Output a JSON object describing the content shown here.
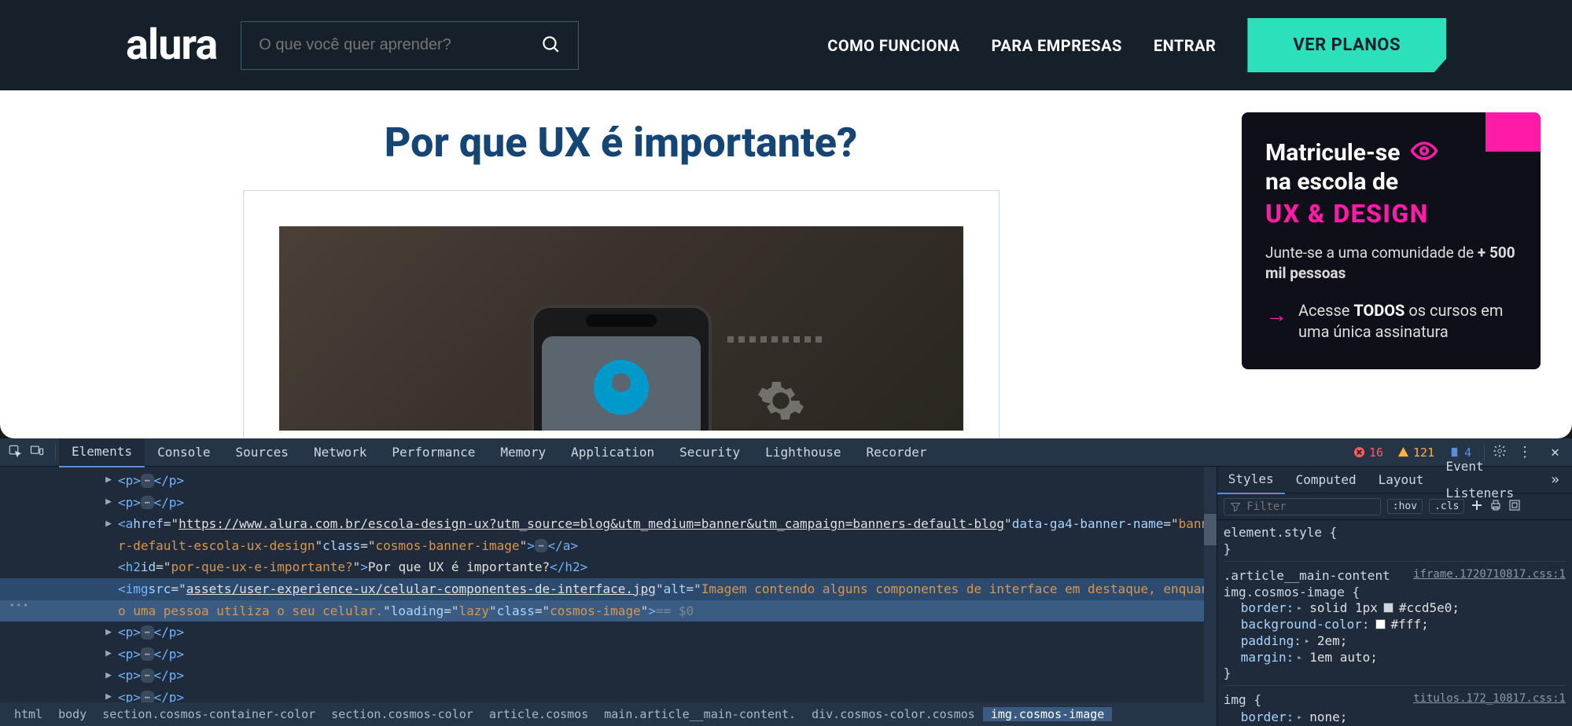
{
  "header": {
    "logo": "alura",
    "search_placeholder": "O que você quer aprender?",
    "nav": {
      "como": "COMO FUNCIONA",
      "empresas": "PARA EMPRESAS",
      "entrar": "ENTRAR",
      "planos": "VER PLANOS"
    }
  },
  "article": {
    "title": "Por que UX é importante?"
  },
  "promo": {
    "line1": "Matricule-se",
    "line2": "na escola de",
    "line3": "UX & DESIGN",
    "sub_prefix": "Junte-se a uma comunidade de ",
    "sub_bold": "+ 500 mil pessoas",
    "access_prefix": "Acesse ",
    "access_bold": "TODOS",
    "access_suffix": " os cursos em uma única assinatura"
  },
  "devtools": {
    "tabs": {
      "elements": "Elements",
      "console": "Console",
      "sources": "Sources",
      "network": "Network",
      "performance": "Performance",
      "memory": "Memory",
      "application": "Application",
      "security": "Security",
      "lighthouse": "Lighthouse",
      "recorder": "Recorder"
    },
    "status": {
      "errors": "16",
      "warnings": "121",
      "info": "4"
    },
    "dom": {
      "a_href": "https://www.alura.com.br/escola-design-ux?utm_source=blog&utm_medium=banner&utm_campaign=banners-default-blog",
      "a_ga4_prefix": "banne",
      "a_ga4_suffix": "r-default-escola-ux-design",
      "a_class": "cosmos-banner-image",
      "h2_id": "por-que-ux-e-importante?",
      "h2_text": "Por que UX é importante?",
      "img_src": "assets/user-experience-ux/celular-componentes-de-interface.jpg",
      "img_alt_prefix": "Imagem contendo alguns componentes de interface em destaque, enquant",
      "img_alt_suffix": "o uma pessoa utiliza o seu celular.",
      "img_loading": "lazy",
      "img_class": "cosmos-image",
      "eq0": " == $0"
    },
    "breadcrumb": {
      "html": "html",
      "body": "body",
      "s1": "section.cosmos-container-color",
      "s2": "section.cosmos-color",
      "art": "article.cosmos",
      "main": "main.article__main-content.",
      "div": "div.cosmos-color.cosmos",
      "img": "img.cosmos-image"
    },
    "styles": {
      "tabs": {
        "styles": "Styles",
        "computed": "Computed",
        "layout": "Layout",
        "listeners": "Event Listeners"
      },
      "filter_placeholder": "Filter",
      "hov": ":hov",
      "cls": ".cls",
      "el_style": "element.style {",
      "rule1_sel1": ".article__main-content",
      "rule1_sel2": "img.cosmos-image {",
      "rule1_src": "iframe.1720710817.css:1",
      "rule1": {
        "border": "border:",
        "border_v": " solid 1px ",
        "border_c": "#ccd5e0;",
        "bg": "background-color:",
        "bg_c": "#fff;",
        "padding": "padding:",
        "padding_v": " 2em;",
        "margin": "margin:",
        "margin_v": " 1em auto;"
      },
      "rule2_sel": "img {",
      "rule2_src": "titulos.172_10817.css:1",
      "rule2": {
        "border": "border:",
        "border_v": " none;"
      }
    }
  }
}
